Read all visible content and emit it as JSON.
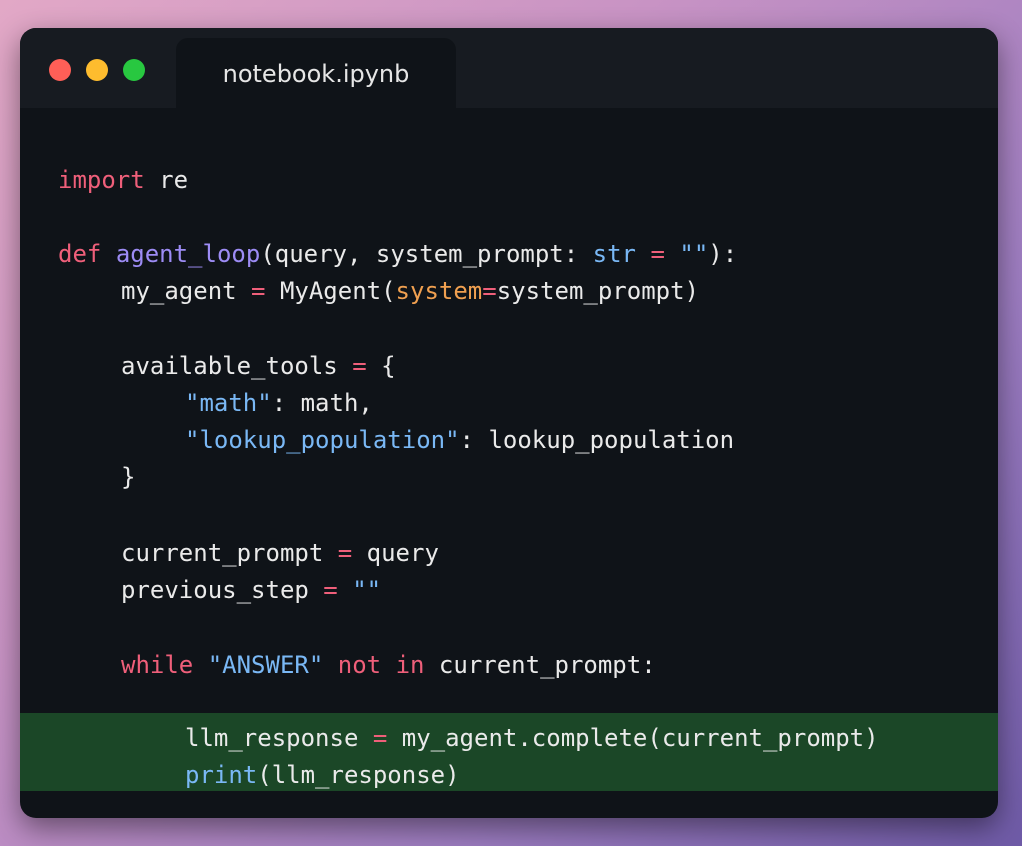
{
  "window": {
    "traffic_lights": [
      {
        "name": "close",
        "color": "#ff5f57"
      },
      {
        "name": "minimize",
        "color": "#febc2e"
      },
      {
        "name": "maximize",
        "color": "#28c840"
      }
    ],
    "tab_title": "notebook.ipynb"
  },
  "colors": {
    "keyword": "#ef5f7a",
    "function": "#9d8cf5",
    "string": "#7ab8f5",
    "param": "#f0a050",
    "highlight_bg": "#1b4727"
  },
  "code": {
    "l1": {
      "kw": "import",
      "rest": " re"
    },
    "l2": {
      "kw": "def",
      "sp": " ",
      "fn": "agent_loop",
      "a": "(query, system_prompt: ",
      "type": "str",
      "sp2": " ",
      "eq": "=",
      "sp3": " ",
      "s": "\"\"",
      "end": "):"
    },
    "l3": {
      "a": "my_agent ",
      "eq": "=",
      "b": " MyAgent(",
      "prm": "system",
      "eq2": "=",
      "c": "system_prompt)"
    },
    "l4": {
      "a": "available_tools ",
      "eq": "=",
      "b": " {"
    },
    "l5": {
      "s": "\"math\"",
      "rest": ": math,"
    },
    "l6": {
      "s": "\"lookup_population\"",
      "rest": ": lookup_population"
    },
    "l7": {
      "a": "}"
    },
    "l8": {
      "a": "current_prompt ",
      "eq": "=",
      "b": " query"
    },
    "l9": {
      "a": "previous_step ",
      "eq": "=",
      "sp": " ",
      "s": "\"\""
    },
    "l10": {
      "kw": "while",
      "sp": " ",
      "s": "\"ANSWER\"",
      "sp2": " ",
      "kw2": "not",
      "sp3": " ",
      "kw3": "in",
      "rest": " current_prompt:"
    },
    "l11": {
      "a": "llm_response ",
      "eq": "=",
      "b": " my_agent.complete(current_prompt)"
    },
    "l12": {
      "bi": "print",
      "rest": "(llm_response)"
    }
  }
}
